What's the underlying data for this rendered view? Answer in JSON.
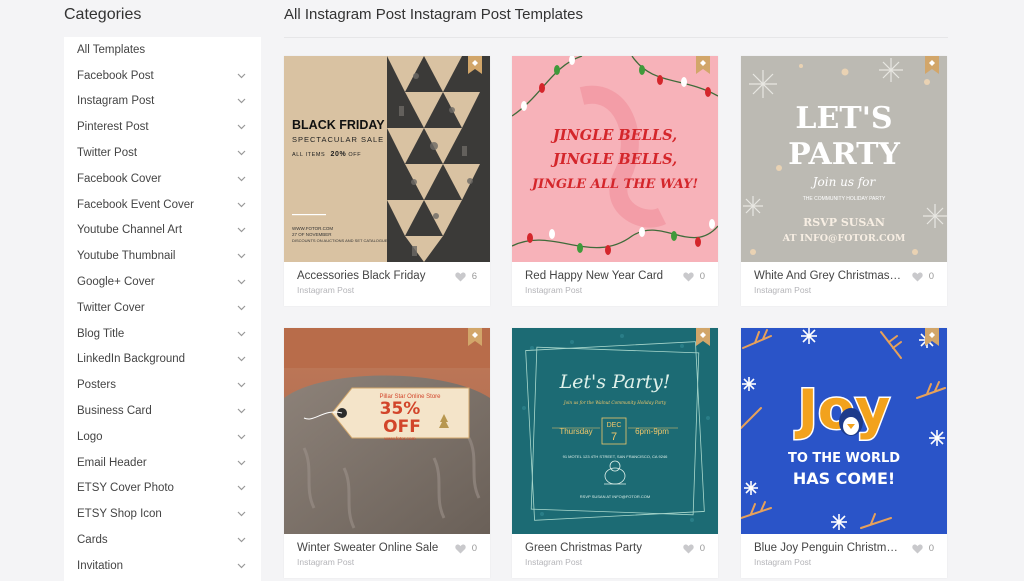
{
  "sidebar": {
    "title": "Categories",
    "items": [
      {
        "label": "All Templates",
        "has_chevron": false
      },
      {
        "label": "Facebook Post",
        "has_chevron": true
      },
      {
        "label": "Instagram Post",
        "has_chevron": true
      },
      {
        "label": "Pinterest Post",
        "has_chevron": true
      },
      {
        "label": "Twitter Post",
        "has_chevron": true
      },
      {
        "label": "Facebook Cover",
        "has_chevron": true
      },
      {
        "label": "Facebook Event Cover",
        "has_chevron": true
      },
      {
        "label": "Youtube Channel Art",
        "has_chevron": true
      },
      {
        "label": "Youtube Thumbnail",
        "has_chevron": true
      },
      {
        "label": "Google+ Cover",
        "has_chevron": true
      },
      {
        "label": "Twitter Cover",
        "has_chevron": true
      },
      {
        "label": "Blog Title",
        "has_chevron": true
      },
      {
        "label": "LinkedIn Background",
        "has_chevron": true
      },
      {
        "label": "Posters",
        "has_chevron": true
      },
      {
        "label": "Business Card",
        "has_chevron": true
      },
      {
        "label": "Logo",
        "has_chevron": true
      },
      {
        "label": "Email Header",
        "has_chevron": true
      },
      {
        "label": "ETSY Cover Photo",
        "has_chevron": true
      },
      {
        "label": "ETSY Shop Icon",
        "has_chevron": true
      },
      {
        "label": "Cards",
        "has_chevron": true
      },
      {
        "label": "Invitation",
        "has_chevron": true
      }
    ]
  },
  "main": {
    "title": "All Instagram Post Instagram Post Templates",
    "cards": [
      {
        "name": "Accessories Black Friday",
        "category": "Instagram Post",
        "likes": "6",
        "art": {
          "l1": "BLACK FRIDAY",
          "l2": "SPECTACULAR SALE",
          "l3": "ALL ITEMS",
          "l3b": "20%",
          "l3c": "OFF",
          "f1": "WWW.FOTOR.COM",
          "f2": "27 OF NOVEMBER",
          "f3": "DISCOUNTS ON AUCTIONS AND SET CATALOGUE!"
        }
      },
      {
        "name": "Red Happy New Year Card",
        "category": "Instagram Post",
        "likes": "0",
        "art": {
          "l1": "JINGLE BELLS,",
          "l2": "JINGLE BELLS,",
          "l3": "JINGLE ALL THE WAY!"
        }
      },
      {
        "name": "White And Grey Christmas Party Instagram Post",
        "category": "Instagram Post",
        "likes": "0",
        "art": {
          "l1": "LET'S",
          "l2": "PARTY",
          "l3": "Join us for",
          "l4": "THE COMMUNITY HOLIDAY PARTY",
          "l5": "RSVP SUSAN",
          "l6": "AT INFO@FOTOR.COM"
        }
      },
      {
        "name": "Winter Sweater Online Sale",
        "category": "Instagram Post",
        "likes": "0",
        "art": {
          "l1": "Pillar Star Online Store",
          "l2": "35%",
          "l3": "OFF",
          "l4": "www.fotor.com"
        }
      },
      {
        "name": "Green Christmas Party",
        "category": "Instagram Post",
        "likes": "0",
        "art": {
          "l1": "Let's Party!",
          "l2": "Join us for the Walnut Community Holiday Party",
          "d1": "Thursday",
          "d2": "DEC",
          "d3": "7",
          "d4": "6pm-9pm",
          "l3": "91 MOTEL 123 4TH STREET, SAN FRANCISCO, CA 9246",
          "l4": "RSVP SUSAN AT INFO@FOTOR.COM"
        }
      },
      {
        "name": "Blue Joy Penguin Christmas Card",
        "category": "Instagram Post",
        "likes": "0",
        "art": {
          "l1": "Joy",
          "l2": "TO THE WORLD",
          "l3": "HAS COME!"
        }
      }
    ]
  },
  "colors": {
    "page_bg": "#f4f4f6",
    "bookmark": "#d2a66a",
    "black_friday_bg": "#d9c2a2",
    "jingle_bg": "#f7b2b9",
    "jingle_text": "#d4262b",
    "party_bg": "#bcbab3",
    "sale_tag": "#f4e4c9",
    "sale_text": "#d2452a",
    "green_bg": "#1c6b74",
    "joy_bg": "#2a54c8",
    "joy_text": "#f2a21d"
  },
  "icons": {
    "chevron": "chevron-down-icon",
    "heart": "heart-icon",
    "bookmark": "bookmark-icon"
  }
}
